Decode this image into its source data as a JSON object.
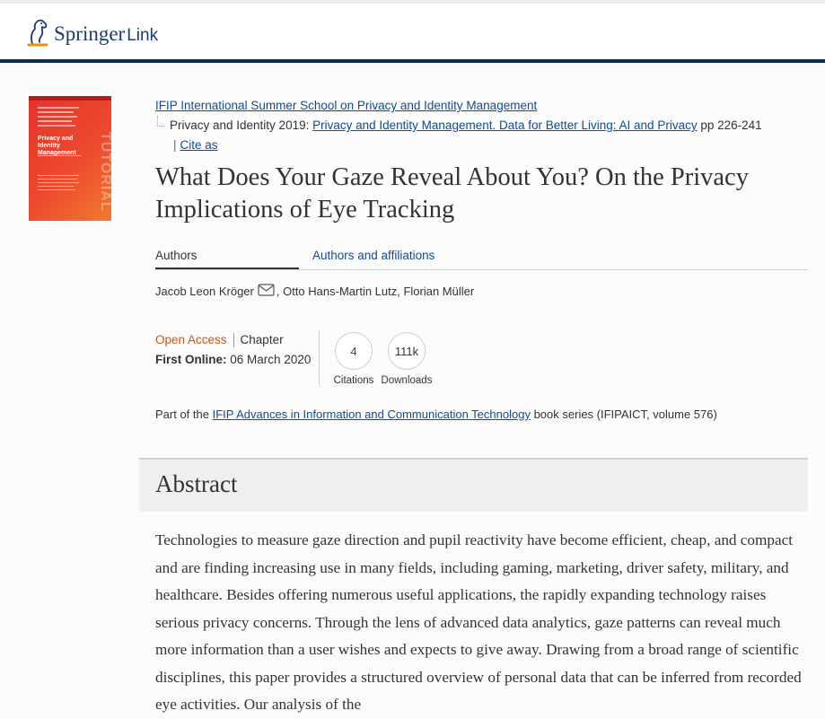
{
  "header": {
    "brand": "Springer",
    "brand_suffix": "Link"
  },
  "cover": {
    "title_lines": [
      "Privacy and Identity",
      "Management"
    ],
    "vertical_text": "TUTORIAL"
  },
  "breadcrumbs": {
    "school": "IFIP International Summer School on Privacy and Identity Management",
    "conference_prefix": "Privacy and Identity 2019:",
    "book_title": "Privacy and Identity Management. Data for Better Living: AI and Privacy",
    "pages": "pp 226-241",
    "cite_as": "Cite as"
  },
  "article": {
    "title": "What Does Your Gaze Reveal About You? On the Privacy Implications of Eye Tracking"
  },
  "tabs": {
    "authors": "Authors",
    "affiliations": "Authors and affiliations"
  },
  "authors": {
    "first": "Jacob Leon Kröger",
    "rest": ", Otto Hans-Martin Lutz, Florian Müller"
  },
  "meta": {
    "open_access": "Open Access",
    "type": "Chapter",
    "first_online_label": "First Online:",
    "first_online_date": "06 March 2020"
  },
  "metrics": {
    "citations_value": "4",
    "citations_label": "Citations",
    "downloads_value": "111k",
    "downloads_label": "Downloads"
  },
  "series": {
    "prefix": "Part of the",
    "name": "IFIP Advances in Information and Communication Technology",
    "suffix": "book series (IFIPAICT, volume 576)"
  },
  "abstract": {
    "heading": "Abstract",
    "text": "Technologies to measure gaze direction and pupil reactivity have become efficient, cheap, and compact and are finding increasing use in many fields, including gaming, marketing, driver safety, military, and healthcare. Besides offering numerous useful applications, the rapidly expanding technology raises serious privacy concerns. Through the lens of advanced data analytics, gaze patterns can reveal much more information than a user wishes and expects to give away. Drawing from a broad range of scientific disciplines, this paper provides a structured overview of personal data that can be inferred from recorded eye activities. Our analysis of the"
  },
  "colors": {
    "link": "#0f4d92",
    "header_bar": "#0d2b55",
    "open_access": "#c7581b",
    "logo_accent": "#f39200"
  }
}
